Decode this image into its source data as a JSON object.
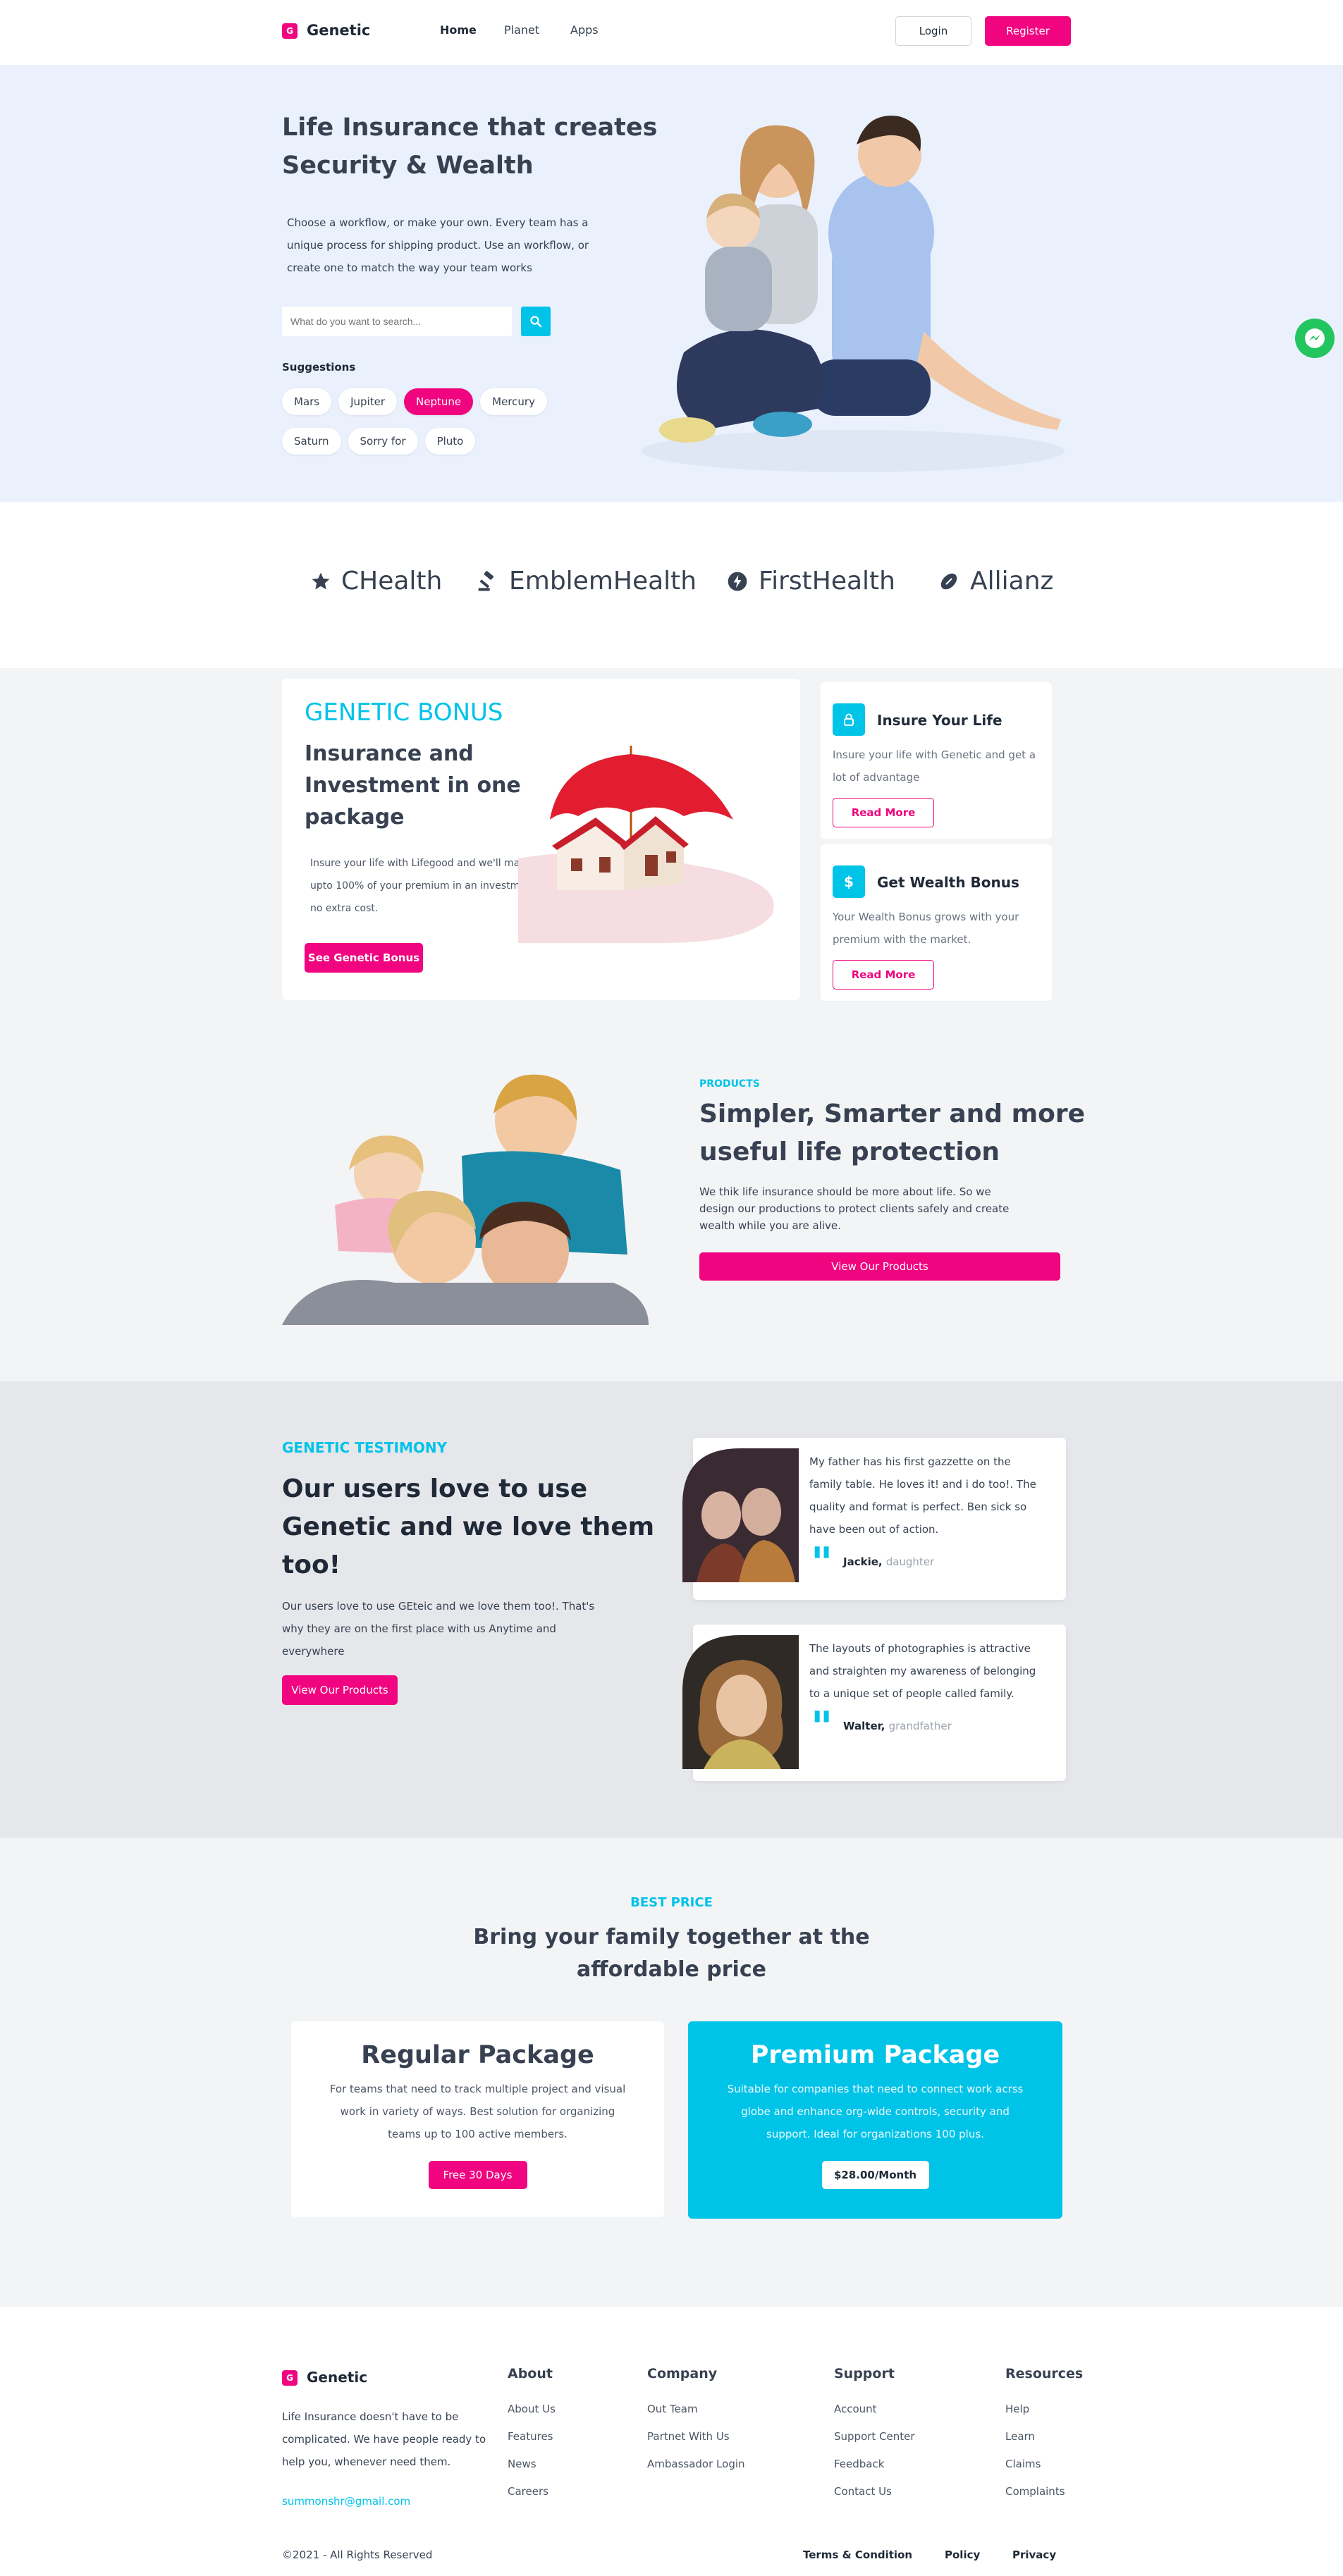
{
  "nav": {
    "logo_letter": "G",
    "brand": "Genetic",
    "links": [
      "Home",
      "Planet",
      "Apps"
    ],
    "login": "Login",
    "register": "Register"
  },
  "hero": {
    "title_line1": "Life Insurance that creates",
    "title_line2": "Security & Wealth",
    "desc_line1": "Choose a workflow, or make your own. Every team has a",
    "desc_line2": "unique process for shipping product. Use an workflow, or",
    "desc_line3": "create one to match the way your team works",
    "search_placeholder": "What do you want to search...",
    "suggestions_label": "Suggestions",
    "chips_row1": [
      "Mars",
      "Jupiter",
      "Neptune",
      "Mercury"
    ],
    "chips_row2": [
      "Saturn",
      "Sorry for",
      "Pluto"
    ],
    "active_chip": "Neptune"
  },
  "brands": [
    "CHealth",
    "EmblemHealth",
    "FirstHealth",
    "Allianz"
  ],
  "bonus": {
    "kicker": "GENETIC BONUS",
    "title_line1": "Insurance and",
    "title_line2": "Investment in one",
    "title_line3": "package",
    "desc_line1": "Insure your life with Lifegood and we'll match",
    "desc_line2": "upto 100% of your premium in an investment - at",
    "desc_line3": "no extra cost.",
    "cta": "See Genetic Bonus"
  },
  "features": [
    {
      "icon": "lock-icon",
      "title": "Insure Your Life",
      "desc_line1": "Insure your life with Genetic and get a",
      "desc_line2": "lot of advantage",
      "cta": "Read More"
    },
    {
      "icon": "dollar-icon",
      "title": "Get Wealth Bonus",
      "desc_line1": "Your Wealth Bonus grows with your",
      "desc_line2": "premium with the market.",
      "cta": "Read More"
    }
  ],
  "products": {
    "kicker": "PRODUCTS",
    "title_line1": "Simpler, Smarter and more",
    "title_line2": "useful life protection",
    "desc_line1": "We thik life insurance should be more about life. So we",
    "desc_line2": "design our productions to protect clients safely and create",
    "desc_line3": "wealth while you are alive.",
    "cta": "View Our Products"
  },
  "testimony": {
    "kicker": "GENETIC TESTIMONY",
    "title_line1": "Our users love to use",
    "title_line2": "Genetic and we love them",
    "title_line3": "too!",
    "desc_line1": "Our users love to use GEteic and we love them too!. That's",
    "desc_line2": "why they are on the first place with us Anytime and",
    "desc_line3": "everywhere",
    "cta": "View Our Products",
    "items": [
      {
        "lines": [
          "My father has his first gazzette on the",
          "family table. He loves it! and i do too!. The",
          "quality and format is perfect. Ben sick so",
          "have been out of action."
        ],
        "name": "Jackie,",
        "role": "daughter"
      },
      {
        "lines": [
          "The layouts of photographies is attractive",
          "and straighten my awareness of belonging",
          "to a unique set of people called family."
        ],
        "name": "Walter,",
        "role": "grandfather"
      }
    ]
  },
  "pricing": {
    "kicker": "BEST PRICE",
    "title_line1": "Bring your family together at the",
    "title_line2": "affordable price",
    "regular": {
      "name": "Regular Package",
      "desc_line1": "For teams that need to track multiple project and visual",
      "desc_line2": "work in variety of ways. Best solution for organizing",
      "desc_line3": "teams up to 100 active members.",
      "cta": "Free 30 Days"
    },
    "premium": {
      "name": "Premium Package",
      "desc_line1": "Suitable for companies that need to connect work acrss",
      "desc_line2": "globe and enhance org-wide controls, security and",
      "desc_line3": "support. Ideal for organizations 100 plus.",
      "cta": "$28.00/Month"
    }
  },
  "footer": {
    "brand": "Genetic",
    "logo_letter": "G",
    "about_line1": "Life Insurance doesn't have to be",
    "about_line2": "complicated. We have people ready to",
    "about_line3": "help you, whenever need them.",
    "email": "summonshr@gmail.com",
    "columns": [
      {
        "title": "About",
        "links": [
          "About Us",
          "Features",
          "News",
          "Careers"
        ]
      },
      {
        "title": "Company",
        "links": [
          "Out Team",
          "Partnet With Us",
          "Ambassador Login"
        ]
      },
      {
        "title": "Support",
        "links": [
          "Account",
          "Support Center",
          "Feedback",
          "Contact Us"
        ]
      },
      {
        "title": "Resources",
        "links": [
          "Help",
          "Learn",
          "Claims",
          "Complaints"
        ]
      }
    ],
    "copyright": "©2021 - All Rights Reserved",
    "bottom_links": [
      "Terms & Condition",
      "Policy",
      "Privacy"
    ]
  },
  "colors": {
    "accent_pink": "#f0047f",
    "accent_cyan": "#00c3e8",
    "hero_bg": "#eaf1fd"
  }
}
